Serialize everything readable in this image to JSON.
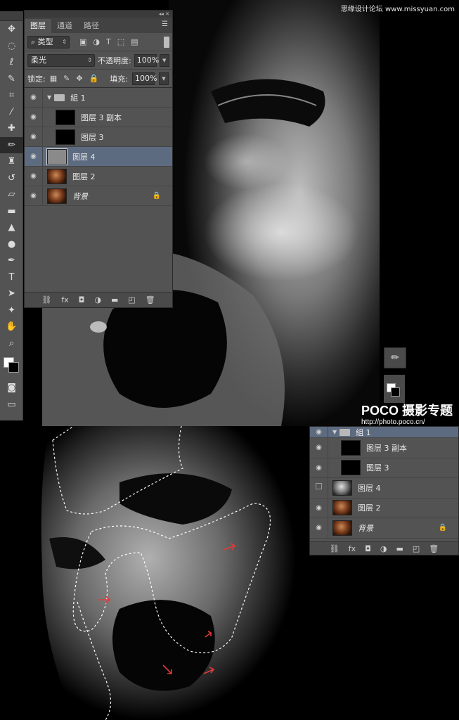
{
  "watermark": "思缘设计论坛 www.missyuan.com",
  "poco": {
    "title": "POCO 摄影专题",
    "url": "http://photo.poco.cn/"
  },
  "panel": {
    "tabs": [
      {
        "label": "图层",
        "active": true
      },
      {
        "label": "通道",
        "active": false
      },
      {
        "label": "路径",
        "active": false
      }
    ],
    "filter": {
      "kind": "类型"
    },
    "blend_mode": "柔光",
    "opacity_label": "不透明度:",
    "opacity_value": "100%",
    "lock_label": "锁定:",
    "fill_label": "填充:",
    "fill_value": "100%",
    "layers": [
      {
        "name": "組 1",
        "type": "group",
        "visible": true
      },
      {
        "name": "图层 3 副本",
        "type": "black",
        "visible": true
      },
      {
        "name": "图层 3",
        "type": "black",
        "visible": true
      },
      {
        "name": "图层 4",
        "type": "gray",
        "visible": true,
        "selected": true
      },
      {
        "name": "图层 2",
        "type": "face",
        "visible": true
      },
      {
        "name": "背景",
        "type": "face",
        "visible": true,
        "locked": true
      }
    ]
  },
  "panel2": {
    "layers": [
      {
        "name": "組 1",
        "type": "group",
        "visible": true
      },
      {
        "name": "图层 3 副本",
        "type": "black",
        "visible": true
      },
      {
        "name": "图层 3",
        "type": "black",
        "visible": true
      },
      {
        "name": "图层 4",
        "type": "bw",
        "visible": false
      },
      {
        "name": "图层 2",
        "type": "face",
        "visible": true
      },
      {
        "name": "背景",
        "type": "face",
        "visible": true,
        "locked": true
      }
    ]
  },
  "colors": {
    "selected_row": "#5d6b80",
    "panel_bg": "#535353",
    "arrow_red": "#e03a3a"
  }
}
